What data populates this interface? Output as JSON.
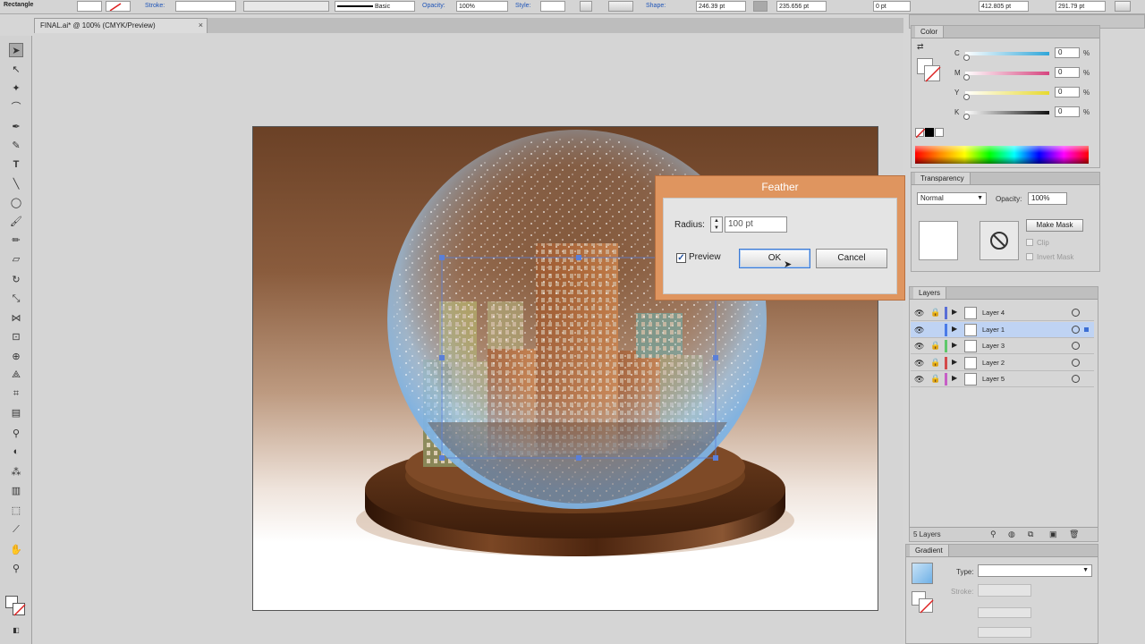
{
  "control_bar": {
    "tool_name": "Rectangle",
    "stroke_label": "Stroke:",
    "brush_label": "Basic",
    "opacity_label": "Opacity:",
    "opacity_value": "100%",
    "style_label": "Style:",
    "shape_label": "Shape:",
    "width_value": "246.39 pt",
    "height_value": "235.656 pt",
    "corner_value": "0 pt",
    "x_value": "412.805 pt",
    "y_value": "291.79 pt"
  },
  "document": {
    "tab_title": "FINAL.ai* @ 100% (CMYK/Preview)",
    "close_glyph": "×"
  },
  "feather_dialog": {
    "title": "Feather",
    "radius_label": "Radius:",
    "radius_value": "100 pt",
    "preview_label": "Preview",
    "preview_checked": true,
    "ok_label": "OK",
    "cancel_label": "Cancel"
  },
  "color_panel": {
    "tab": "Color",
    "channels": [
      {
        "label": "C",
        "value": "0",
        "unit": "%"
      },
      {
        "label": "M",
        "value": "0",
        "unit": "%"
      },
      {
        "label": "Y",
        "value": "0",
        "unit": "%"
      },
      {
        "label": "K",
        "value": "0",
        "unit": "%"
      }
    ]
  },
  "transparency_panel": {
    "tab": "Transparency",
    "blend_mode": "Normal",
    "opacity_label": "Opacity:",
    "opacity_value": "100%",
    "make_mask_label": "Make Mask",
    "clip_label": "Clip",
    "invert_mask_label": "Invert Mask"
  },
  "layers_panel": {
    "tab": "Layers",
    "layers": [
      {
        "name": "Layer 4",
        "color": "#5a6fd6",
        "locked": true,
        "active": false
      },
      {
        "name": "Layer 1",
        "color": "#4a7be8",
        "locked": false,
        "active": true
      },
      {
        "name": "Layer 3",
        "color": "#5fc86a",
        "locked": true,
        "active": false
      },
      {
        "name": "Layer 2",
        "color": "#d34b4b",
        "locked": true,
        "active": false
      },
      {
        "name": "Layer 5",
        "color": "#c65fc6",
        "locked": true,
        "active": false
      }
    ],
    "footer": "5 Layers"
  },
  "gradient_panel": {
    "tab": "Gradient",
    "type_label": "Type:",
    "stroke_label": "Stroke:"
  },
  "colors": {
    "accent_dialog": "#df955f",
    "selection_blue": "#4a7be8"
  }
}
